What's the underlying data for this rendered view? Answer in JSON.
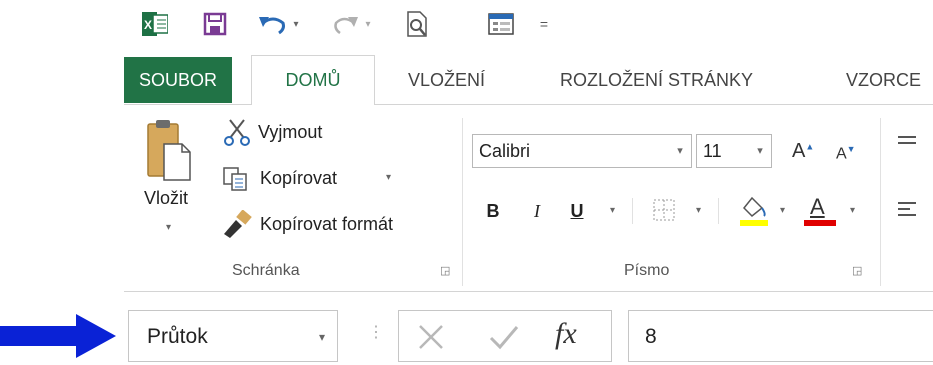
{
  "quick_access": {
    "icons": [
      "excel-logo",
      "save-icon",
      "undo-icon",
      "redo-icon",
      "print-preview-icon",
      "form-icon",
      "customize-qat"
    ],
    "customize_symbol": "="
  },
  "tabs": [
    {
      "label": "SOUBOR"
    },
    {
      "label": "DOMŮ"
    },
    {
      "label": "VLOŽENÍ"
    },
    {
      "label": "ROZLOŽENÍ STRÁNKY"
    },
    {
      "label": "VZORCE"
    }
  ],
  "clipboard": {
    "paste_label": "Vložit",
    "cut_label": "Vyjmout",
    "copy_label": "Kopírovat",
    "format_painter_label": "Kopírovat formát",
    "group_label": "Schránka"
  },
  "font": {
    "font_name": "Calibri",
    "font_size": "11",
    "bold_label": "B",
    "italic_label": "I",
    "underline_label": "U",
    "font_color_label": "A",
    "group_label": "Písmo",
    "grow_label": "A",
    "shrink_label": "A"
  },
  "formula_bar": {
    "name_box_value": "Průtok",
    "formula_value": "8",
    "fx_label": "fx"
  },
  "colors": {
    "accent": "#217346",
    "highlight_color": "#ffff00",
    "font_color": "#e00000",
    "arrow_color": "#0a22d6"
  }
}
